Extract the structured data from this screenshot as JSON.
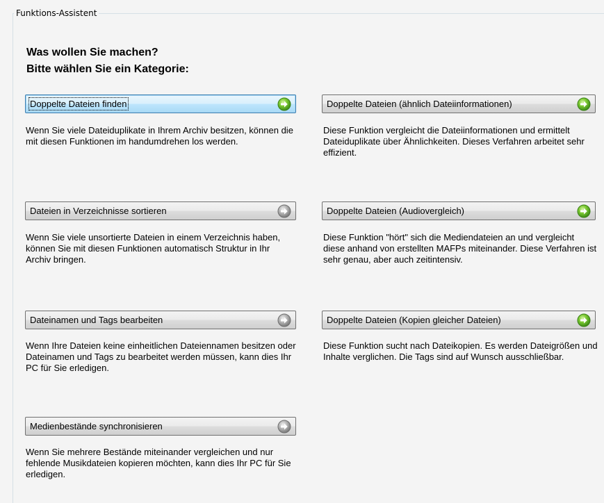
{
  "group": {
    "legend": "Funktions-Assistent"
  },
  "heading": {
    "line1": "Was wollen Sie machen?",
    "line2": "Bitte wählen Sie ein Kategorie:"
  },
  "options": {
    "left": [
      {
        "button_label": "Doppelte Dateien finden",
        "icon": "green-arrow-icon",
        "description": "Wenn Sie viele Dateiduplikate in Ihrem Archiv besitzen, können die mit diesen Funktionen im handumdrehen los werden."
      },
      {
        "button_label": "Dateien in Verzeichnisse sortieren",
        "icon": "gray-arrow-icon",
        "description": "Wenn Sie viele unsortierte Dateien in einem Verzeichnis haben, können Sie mit diesen Funktionen automatisch Struktur in Ihr Archiv bringen."
      },
      {
        "button_label": "Dateinamen und Tags bearbeiten",
        "icon": "gray-arrow-icon",
        "description": "Wenn Ihre Dateien keine einheitlichen Dateiennamen besitzen oder Dateinamen und Tags zu bearbeitet werden müssen,  kann dies Ihr PC für Sie erledigen."
      },
      {
        "button_label": "Medienbestände synchronisieren",
        "icon": "gray-arrow-icon",
        "description": "Wenn Sie mehrere Bestände miteinander vergleichen und nur fehlende Musikdateien kopieren möchten, kann dies Ihr PC für Sie erledigen."
      }
    ],
    "right": [
      {
        "button_label": "Doppelte Dateien (ähnlich Dateiinformationen)",
        "icon": "green-arrow-icon",
        "description": "Diese Funktion vergleicht die Dateiinformationen und ermittelt Dateiduplikate über Ähnlichkeiten.  Dieses Verfahren arbeitet sehr effizient."
      },
      {
        "button_label": "Doppelte Dateien (Audiovergleich)",
        "icon": "green-arrow-icon",
        "description": "Diese Funktion \"hört\" sich die Mediendateien an und vergleicht diese anhand von erstellten MAFPs miteinander.  Diese Verfahren ist sehr genau, aber auch zeitintensiv."
      },
      {
        "button_label": "Doppelte Dateien (Kopien gleicher Dateien)",
        "icon": "green-arrow-icon",
        "description": "Diese Funktion sucht nach Dateikopien.  Es werden Dateigrößen und Inhalte verglichen. Die Tags sind auf Wunsch ausschließbar."
      }
    ]
  },
  "colors": {
    "green_arrow": "#5cb82a",
    "gray_arrow": "#9a9a9a"
  }
}
